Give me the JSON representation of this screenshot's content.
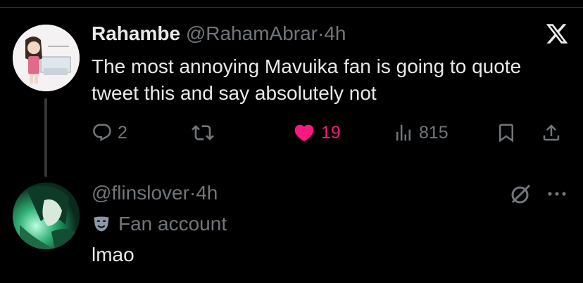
{
  "tweet": {
    "display_name": "Rahambe",
    "handle": "@RahamAbrar",
    "separator": "·",
    "time": "4h",
    "text": "The most annoying Mavuika fan is going to quote tweet this and say absolutely not",
    "actions": {
      "replies": "2",
      "likes": "19",
      "views": "815"
    },
    "liked": true
  },
  "reply": {
    "handle": "@flinslover",
    "separator": "·",
    "time": "4h",
    "badge_label": "Fan account",
    "text": "lmao"
  },
  "colors": {
    "background": "#000000",
    "text": "#e7e9ea",
    "muted": "#71767b",
    "like": "#f91880",
    "divider": "#2f3336"
  },
  "icons": [
    "x-logo-icon",
    "reply-icon",
    "retweet-icon",
    "heart-icon",
    "views-icon",
    "bookmark-icon",
    "share-icon",
    "mask-icon",
    "grok-icon",
    "more-icon"
  ]
}
